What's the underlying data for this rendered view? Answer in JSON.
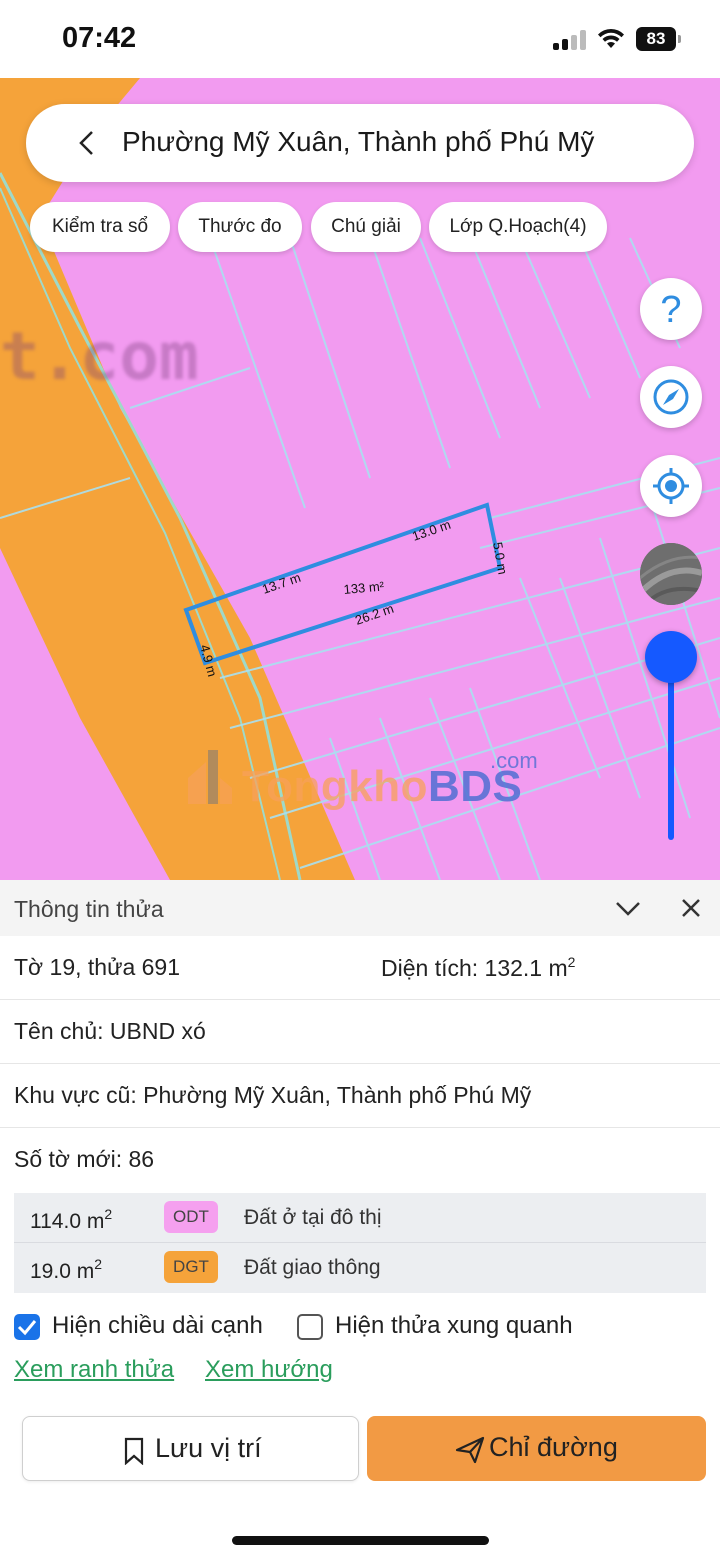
{
  "status_bar": {
    "time": "07:42",
    "battery": "83"
  },
  "search": {
    "title": "Phường Mỹ Xuân, Thành phố Phú Mỹ"
  },
  "chips": [
    "Kiểm tra sổ",
    "Thước đo",
    "Chú giải",
    "Lớp Q.Hoạch(4)"
  ],
  "map": {
    "lot_edges": [
      "13.0 m",
      "5.0 m",
      "26.2 m",
      "4.9 m",
      "13.7 m"
    ],
    "lot_area": "133 m²",
    "watermark_top": "t.com",
    "watermark": {
      "part1": "Tongkho",
      "part2": "BDS",
      "suffix": ".com"
    },
    "colors": {
      "residential": "#f29bf0",
      "road": "#f5a33a",
      "lot_outline": "#2f8de0"
    }
  },
  "panel": {
    "title": "Thông tin thửa",
    "sheet_plot": "Tờ 19, thửa 691",
    "area_label": "Diện tích: 132.1 m",
    "area_sup": "2",
    "owner": "Tên chủ: UBND xó",
    "old_area": "Khu vực cũ: Phường Mỹ Xuân, Thành phố Phú Mỹ",
    "new_sheet": "Số tờ mới: 86",
    "land_use": [
      {
        "area": "114.0 m",
        "sup": "2",
        "code": "ODT",
        "name": "Đất ở tại đô thị",
        "color": "#f5a0ef"
      },
      {
        "area": "19.0 m",
        "sup": "2",
        "code": "DGT",
        "name": "Đất giao thông",
        "color": "#f5a33a"
      }
    ],
    "checkboxes": [
      {
        "label": "Hiện chiều dài cạnh",
        "checked": true
      },
      {
        "label": "Hiện thửa xung quanh",
        "checked": false
      }
    ],
    "links": [
      "Xem ranh thửa",
      "Xem hướng"
    ],
    "buttons": {
      "save": "Lưu vị trí",
      "directions": "Chỉ đường"
    }
  }
}
